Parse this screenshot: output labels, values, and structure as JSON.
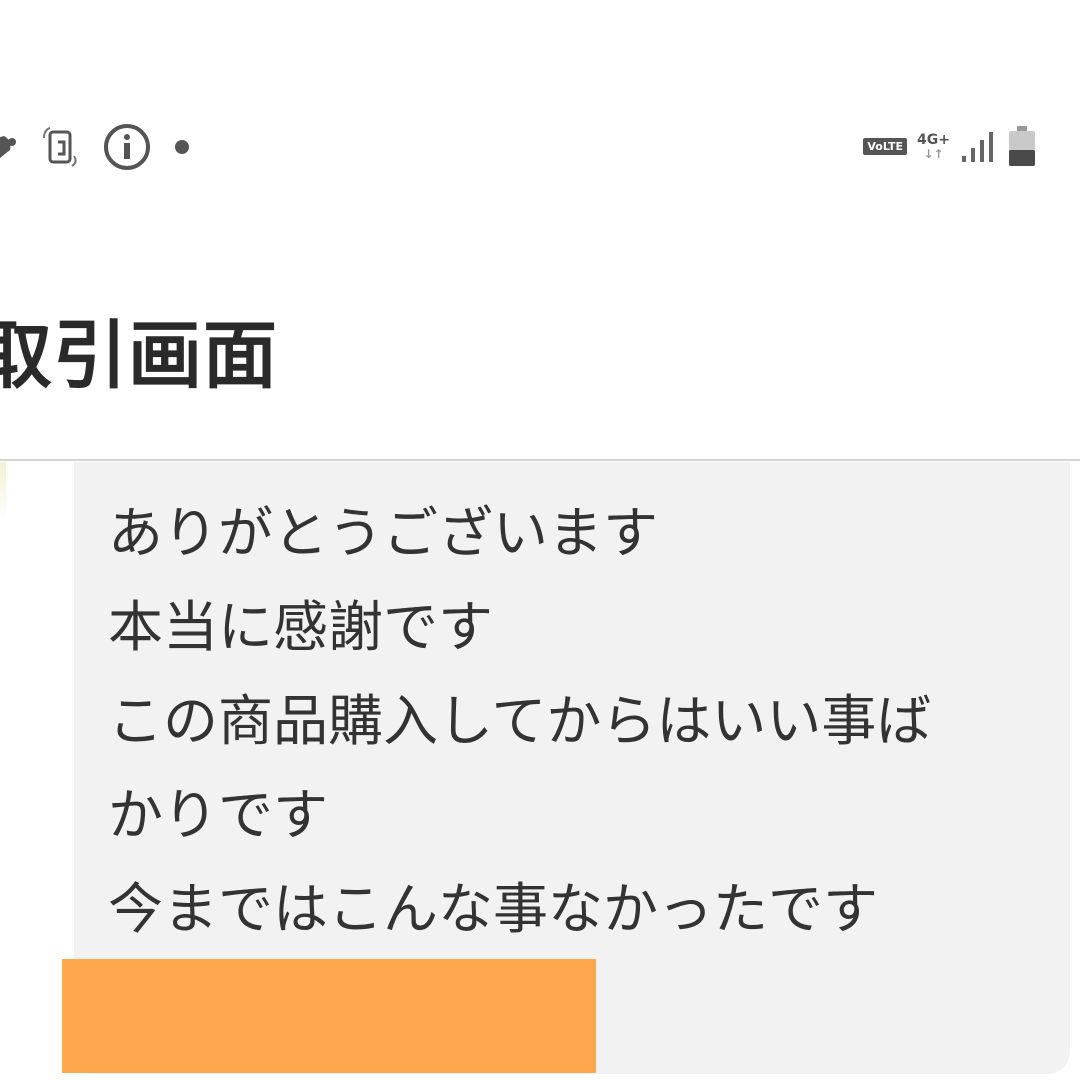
{
  "status_bar": {
    "left_icons": [
      "notification-app-icon",
      "phone-rotate-icon",
      "info-icon",
      "dot-icon"
    ],
    "volte_label": "VoLTE",
    "network_label": "4G+",
    "network_arrows": "↓↑",
    "right_icons": [
      "signal-icon",
      "battery-icon"
    ]
  },
  "header": {
    "title": "取引画面"
  },
  "message": {
    "lines": [
      "ありがとうございます",
      "本当に感謝です",
      "この商品購入してからはいい事ば",
      "かりです",
      "今まではこんな事なかったです"
    ]
  },
  "colors": {
    "background": "#ffffff",
    "bubble": "#f2f2f2",
    "text": "#333333",
    "redaction": "#fea74f",
    "divider": "#d4d4d4"
  }
}
